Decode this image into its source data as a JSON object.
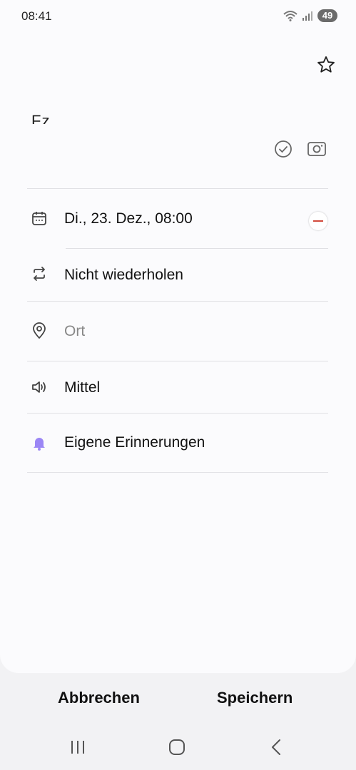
{
  "status_bar": {
    "time": "08:41",
    "battery": "49"
  },
  "event": {
    "title_partial": "Fz"
  },
  "rows": {
    "date": "Di., 23. Dez., 08:00",
    "repeat": "Nicht wiederholen",
    "location_placeholder": "Ort",
    "sound": "Mittel",
    "reminders": "Eigene Erinnerungen"
  },
  "footer": {
    "cancel": "Abbrechen",
    "save": "Speichern"
  },
  "colors": {
    "accent_bell": "#9b86f5",
    "minus_red": "#d24a3c"
  }
}
